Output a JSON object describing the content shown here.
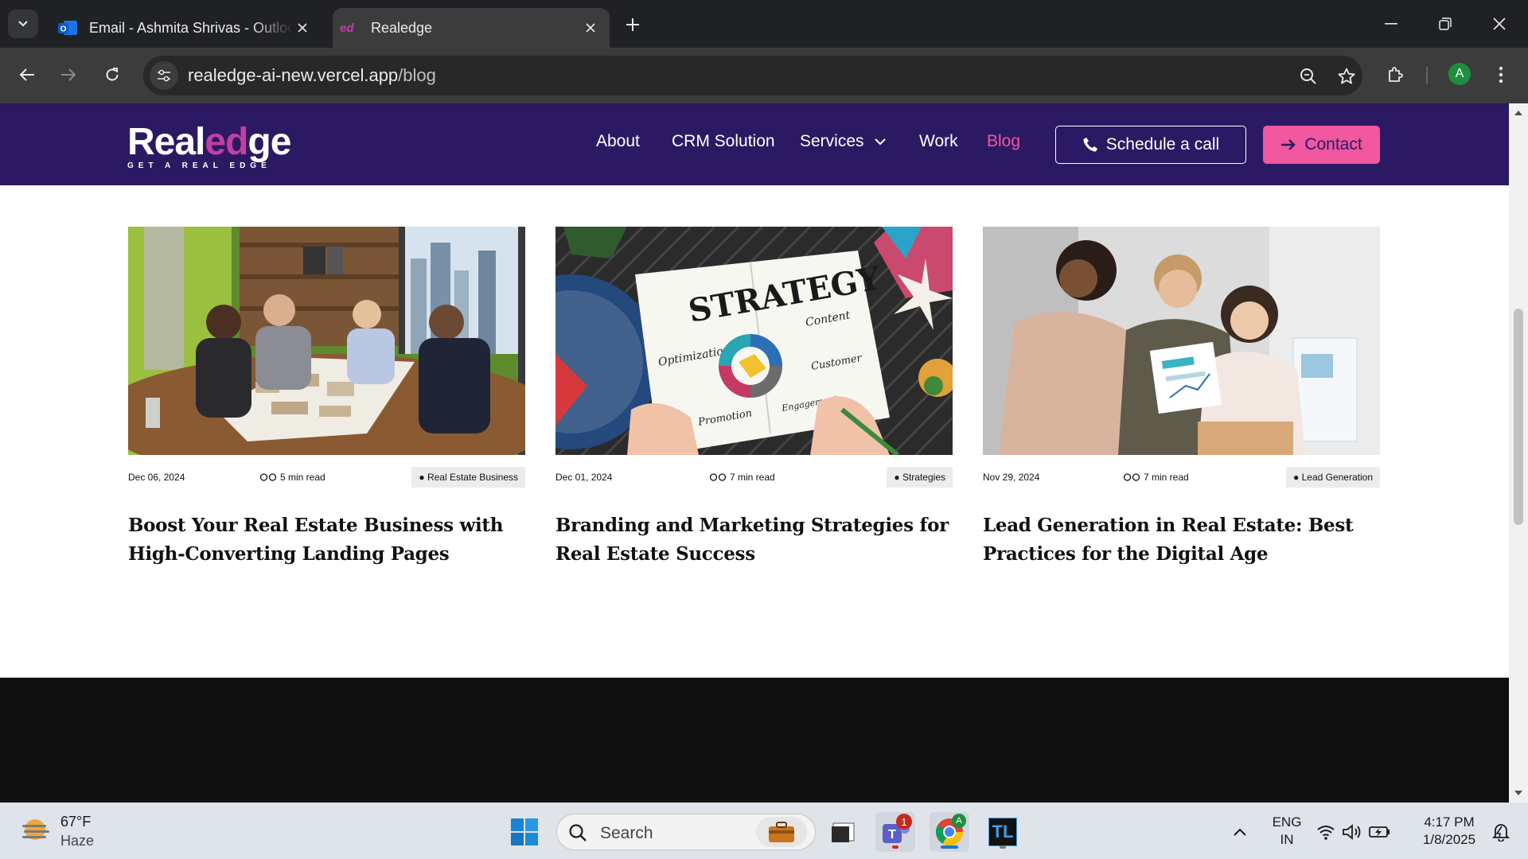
{
  "browser": {
    "tabs": [
      {
        "title": "Email - Ashmita Shrivas - Outlook",
        "active": false
      },
      {
        "title": "Realedge",
        "active": true
      }
    ],
    "url_host": "realedge-ai-new.vercel.app",
    "url_path": "/blog",
    "profile_initial": "A"
  },
  "site": {
    "logo": {
      "text_start": "Real",
      "text_accent": "ed",
      "text_end": "ge",
      "tagline": "GET A REAL EDGE"
    },
    "nav": {
      "about": "About",
      "crm": "CRM Solution",
      "services": "Services",
      "work": "Work",
      "blog": "Blog"
    },
    "schedule_button": "Schedule a call",
    "contact_button": "Contact",
    "colors": {
      "header_bg": "#2b1a63",
      "accent_pink": "#f0579f",
      "footer_bg": "#0f0f0f"
    }
  },
  "posts": [
    {
      "date": "Dec 06, 2024",
      "read_time": "5 min read",
      "tag": "● Real Estate Business",
      "title": "Boost Your Real Estate Business with High-Converting Landing Pages"
    },
    {
      "date": "Dec 01, 2024",
      "read_time": "7 min read",
      "tag": "● Strategies",
      "title": "Branding and Marketing Strategies for Real Estate Success"
    },
    {
      "date": "Nov 29, 2024",
      "read_time": "7 min read",
      "tag": "● Lead Generation",
      "title": "Lead Generation in Real Estate: Best Practices for the Digital Age"
    }
  ],
  "strategy_image_words": {
    "main": "STRATEGY",
    "w1": "Content",
    "w2": "Optimization",
    "w3": "Customer",
    "w4": "Promotion",
    "w5": "Engagement"
  },
  "taskbar": {
    "weather_temp": "67°F",
    "weather_desc": "Haze",
    "search_placeholder": "Search",
    "teams_badge": "1",
    "chrome_badge": "A",
    "tl_label": "TL",
    "lang_line1": "ENG",
    "lang_line2": "IN",
    "time": "4:17 PM",
    "date": "1/8/2025"
  }
}
